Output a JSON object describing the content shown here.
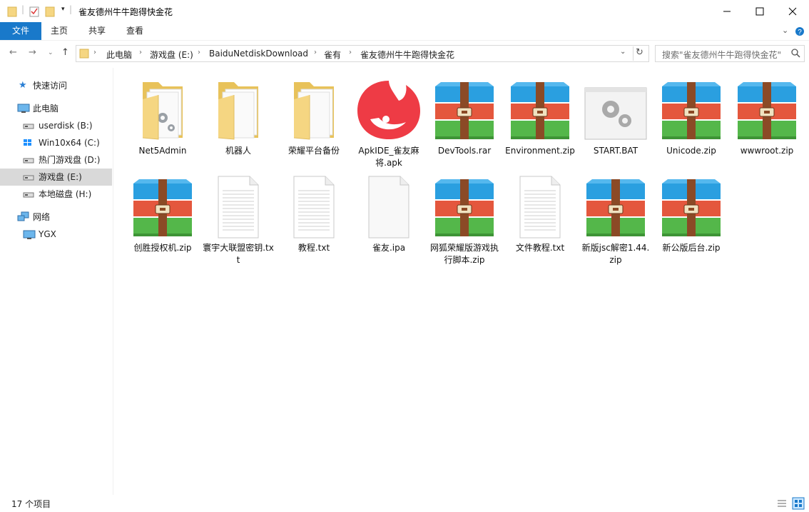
{
  "window": {
    "title": "雀友德州牛牛跑得快金花"
  },
  "ribbon": {
    "tabs": [
      "文件",
      "主页",
      "共享",
      "查看"
    ]
  },
  "address": {
    "crumbs": [
      "此电脑",
      "游戏盘 (E:)",
      "BaiduNetdiskDownload",
      "雀有",
      "雀友德州牛牛跑得快金花"
    ]
  },
  "search": {
    "placeholder": "搜索\"雀友德州牛牛跑得快金花\""
  },
  "nav": {
    "quick_access": "快速访问",
    "this_pc": "此电脑",
    "drives": [
      "userdisk (B:)",
      "Win10x64 (C:)",
      "热门游戏盘 (D:)",
      "游戏盘 (E:)",
      "本地磁盘 (H:)"
    ],
    "network": "网络",
    "ygx": "YGX"
  },
  "files": [
    {
      "name": "Net5Admin",
      "icon": "folder-gear-icon"
    },
    {
      "name": "机器人",
      "icon": "folder-icon"
    },
    {
      "name": "荣耀平台备份",
      "icon": "folder-icon"
    },
    {
      "name": "ApkIDE_雀友麻将.apk",
      "icon": "apk-app-icon"
    },
    {
      "name": "DevTools.rar",
      "icon": "winrar-archive-icon"
    },
    {
      "name": "Environment.zip",
      "icon": "winrar-archive-icon"
    },
    {
      "name": "START.BAT",
      "icon": "batch-file-icon"
    },
    {
      "name": "Unicode.zip",
      "icon": "winrar-archive-icon"
    },
    {
      "name": "wwwroot.zip",
      "icon": "winrar-archive-icon"
    },
    {
      "name": "创胜授权机.zip",
      "icon": "winrar-archive-icon"
    },
    {
      "name": "寰宇大联盟密钥.txt",
      "icon": "text-file-icon"
    },
    {
      "name": "教程.txt",
      "icon": "text-file-icon"
    },
    {
      "name": "雀友.ipa",
      "icon": "blank-file-icon"
    },
    {
      "name": "网狐荣耀版游戏执行脚本.zip",
      "icon": "winrar-archive-icon"
    },
    {
      "name": "文件教程.txt",
      "icon": "text-file-icon"
    },
    {
      "name": "新版jsc解密1.44.zip",
      "icon": "winrar-archive-icon"
    },
    {
      "name": "新公版后台.zip",
      "icon": "winrar-archive-icon"
    }
  ],
  "status": {
    "count": "17 个项目"
  },
  "colors": {
    "accent": "#1979ca",
    "folder": "#f5d682",
    "archive_blue": "#2a9fe0",
    "archive_red": "#e4573d",
    "archive_green": "#54b74a",
    "archive_strap": "#8b4a26"
  }
}
